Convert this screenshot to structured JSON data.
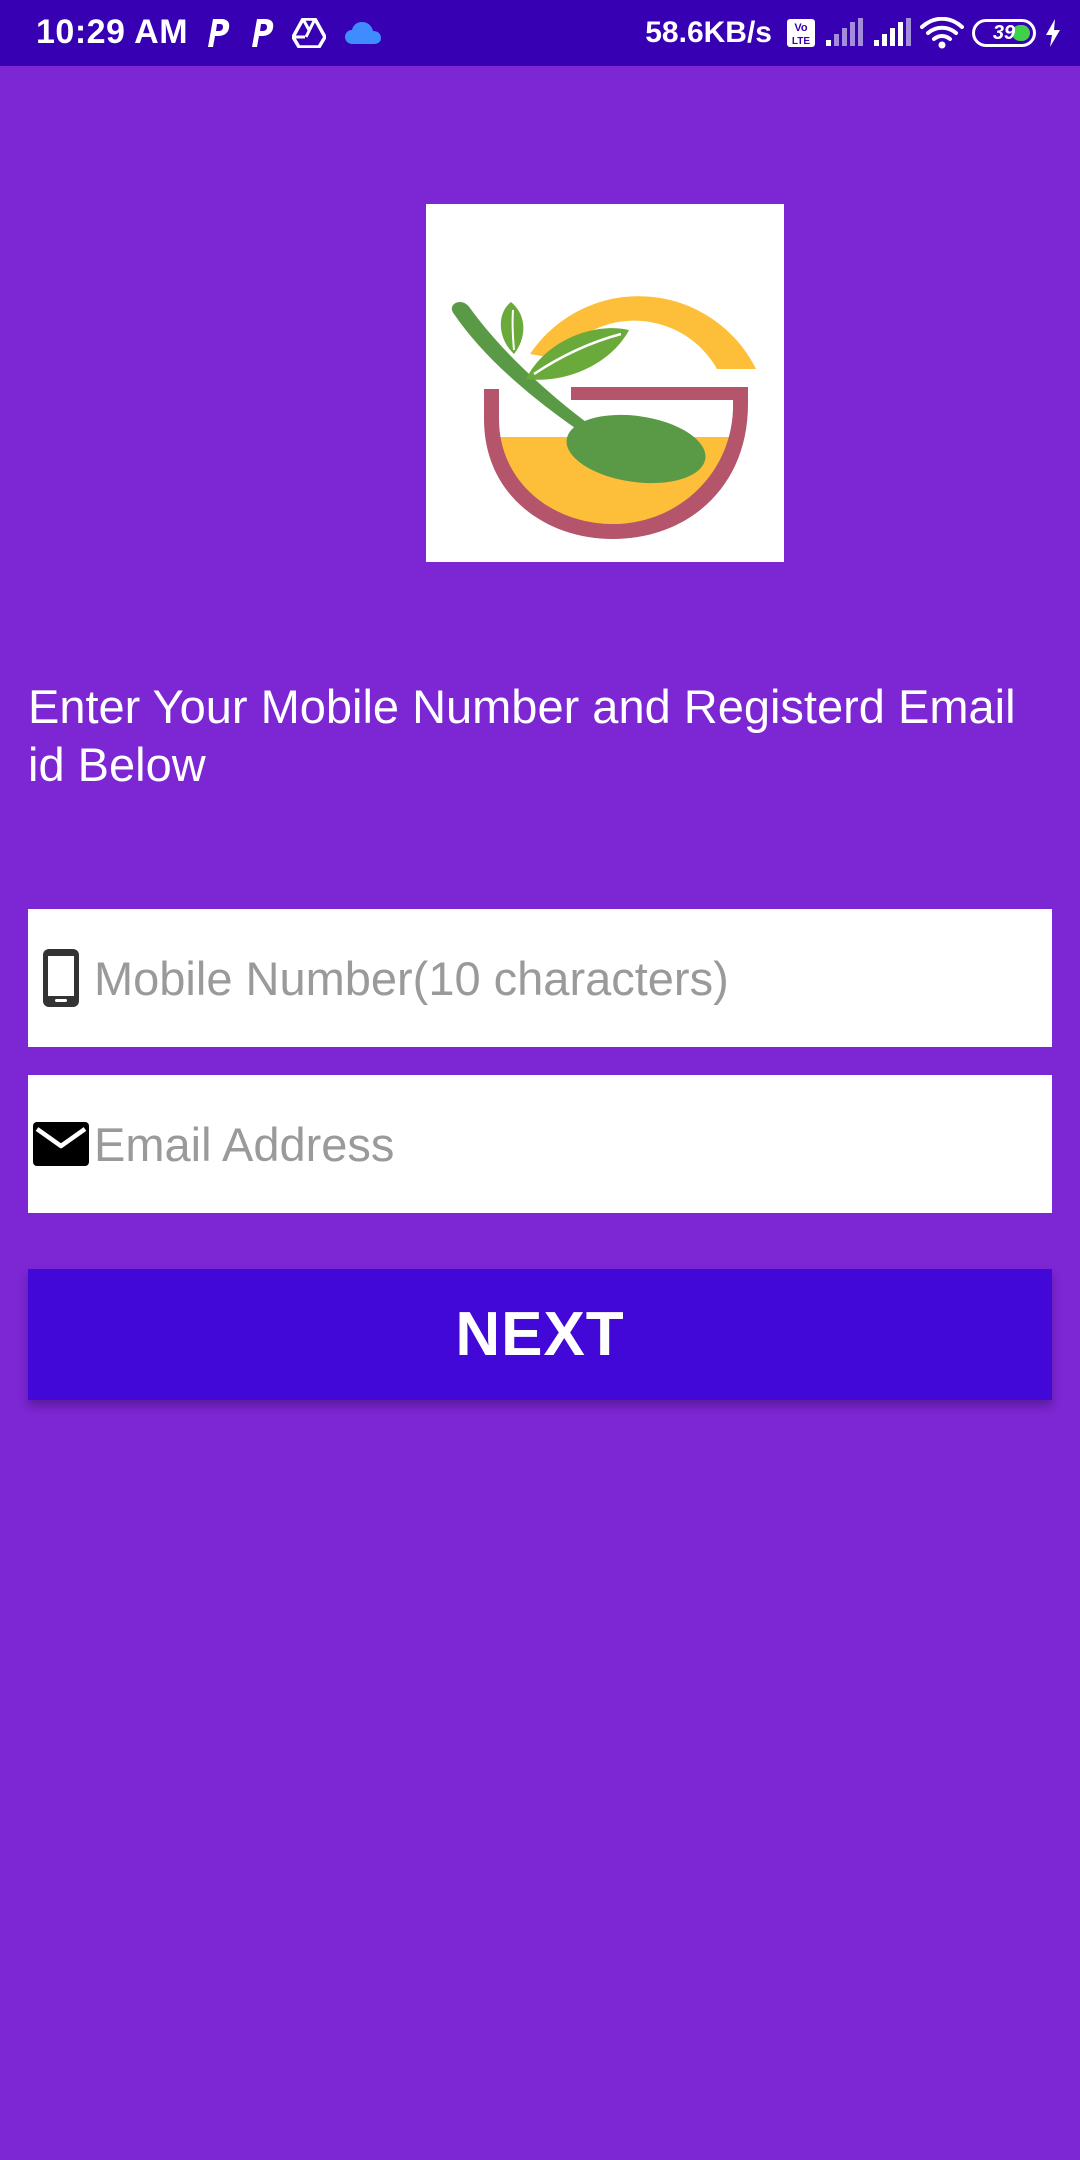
{
  "status_bar": {
    "time": "10:29 AM",
    "network_speed": "58.6KB/s",
    "battery_level": "39",
    "background_color": "#3700b3",
    "icons": [
      "p-app-icon",
      "p-app-icon",
      "drive-icon",
      "cloud-icon",
      "volte-icon",
      "signal-icon",
      "signal-icon",
      "wifi-icon",
      "battery-icon",
      "charging-icon"
    ]
  },
  "screen": {
    "background_color": "#7c26d4",
    "logo_icon": "food-bowl-spoon-leaf-logo",
    "instruction": "Enter Your Mobile Number and Registerd Email id Below",
    "mobile_field": {
      "placeholder": "Mobile Number(10 characters)",
      "value": "",
      "icon": "phone-icon"
    },
    "email_field": {
      "placeholder": "Email Address",
      "value": "",
      "icon": "mail-icon"
    },
    "next_button": {
      "label": "NEXT",
      "color": "#4208d8"
    }
  }
}
